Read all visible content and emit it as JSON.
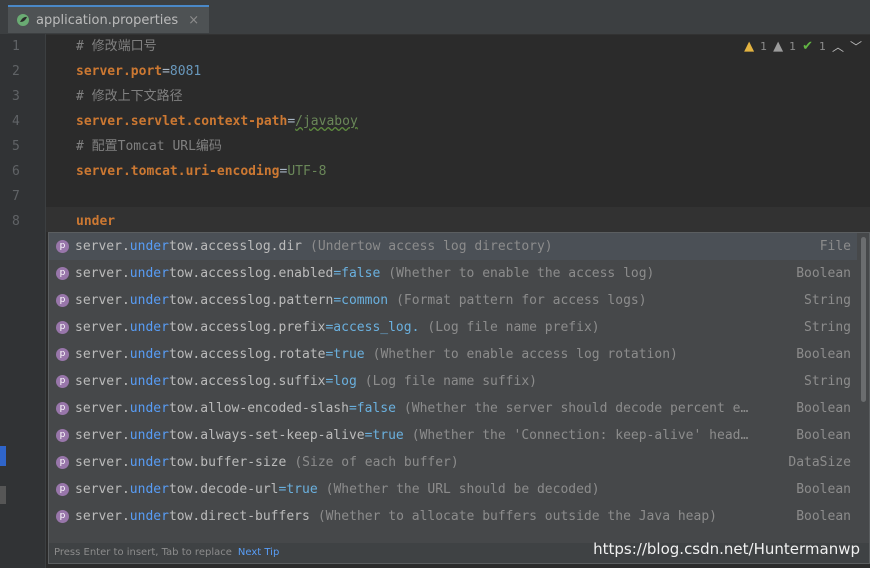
{
  "tab": {
    "title": "application.properties",
    "close": "×"
  },
  "inspections": {
    "warnings": "1",
    "weak": "1",
    "ok": "1"
  },
  "lines": [
    {
      "n": "1",
      "comment": "# 修改端口号"
    },
    {
      "n": "2",
      "key": "server.port",
      "value": "8081"
    },
    {
      "n": "3",
      "comment": "# 修改上下文路径"
    },
    {
      "n": "4",
      "key": "server.servlet.context-path",
      "value": "/javaboy"
    },
    {
      "n": "5",
      "comment": "# 配置Tomcat URL编码"
    },
    {
      "n": "6",
      "key": "server.tomcat.uri-encoding",
      "value": "UTF-8"
    },
    {
      "n": "7"
    },
    {
      "n": "8",
      "typed": "under"
    }
  ],
  "completion": {
    "items": [
      {
        "pre": "server.",
        "match": "under",
        "post": "tow.accesslog.dir",
        "val": "",
        "desc": "(Undertow access log directory)",
        "type": "File"
      },
      {
        "pre": "server.",
        "match": "under",
        "post": "tow.accesslog.enabled",
        "val": "=false",
        "desc": "(Whether to enable the access log)",
        "type": "Boolean"
      },
      {
        "pre": "server.",
        "match": "under",
        "post": "tow.accesslog.pattern",
        "val": "=common",
        "desc": "(Format pattern for access logs)",
        "type": "String"
      },
      {
        "pre": "server.",
        "match": "under",
        "post": "tow.accesslog.prefix",
        "val": "=access_log.",
        "desc": "(Log file name prefix)",
        "type": "String"
      },
      {
        "pre": "server.",
        "match": "under",
        "post": "tow.accesslog.rotate",
        "val": "=true",
        "desc": "(Whether to enable access log rotation)",
        "type": "Boolean"
      },
      {
        "pre": "server.",
        "match": "under",
        "post": "tow.accesslog.suffix",
        "val": "=log",
        "desc": "(Log file name suffix)",
        "type": "String"
      },
      {
        "pre": "server.",
        "match": "under",
        "post": "tow.allow-encoded-slash",
        "val": "=false",
        "desc": "(Whether the server should decode percent e…",
        "type": "Boolean"
      },
      {
        "pre": "server.",
        "match": "under",
        "post": "tow.always-set-keep-alive",
        "val": "=true",
        "desc": "(Whether the 'Connection: keep-alive' head…",
        "type": "Boolean"
      },
      {
        "pre": "server.",
        "match": "under",
        "post": "tow.buffer-size",
        "val": "",
        "desc": "(Size of each buffer)",
        "type": "DataSize"
      },
      {
        "pre": "server.",
        "match": "under",
        "post": "tow.decode-url",
        "val": "=true",
        "desc": "(Whether the URL should be decoded)",
        "type": "Boolean"
      },
      {
        "pre": "server.",
        "match": "under",
        "post": "tow.direct-buffers",
        "val": "",
        "desc": "(Whether to allocate buffers outside the Java heap)",
        "type": "Boolean"
      }
    ],
    "footer": {
      "hint": "Press Enter to insert, Tab to replace",
      "next_tip": "Next Tip"
    }
  },
  "watermark": "https://blog.csdn.net/Huntermanwp",
  "colors": {
    "background": "#2b2b2b",
    "popup": "#46484a",
    "selection": "#4b5056",
    "match": "#589df6"
  }
}
